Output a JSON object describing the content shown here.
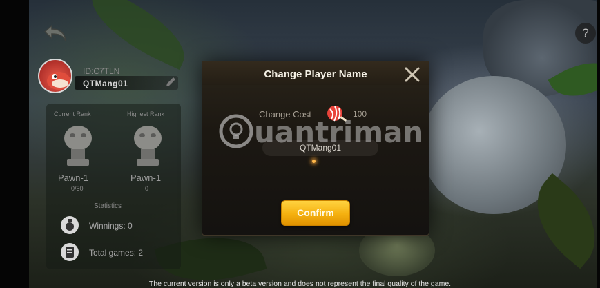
{
  "player": {
    "id_label": "ID:C7TLN",
    "name": "QTMang01"
  },
  "ranks": {
    "current": {
      "title": "Current Rank",
      "name": "Pawn-1",
      "progress": "0/50"
    },
    "highest": {
      "title": "Highest Rank",
      "name": "Pawn-1",
      "progress": "0"
    }
  },
  "statistics": {
    "title": "Statistics",
    "winnings": "Winnings: 0",
    "total_games": "Total games: 2"
  },
  "dialog": {
    "title": "Change Player Name",
    "cost_label": "Change Cost",
    "cost_value": "100",
    "name_value": "QTMang01",
    "confirm_label": "Confirm"
  },
  "help_label": "?",
  "footer_note": "The current version is only a beta version and does not represent the final quality of the game.",
  "watermark_text": "Quantrimang",
  "colors": {
    "confirm_button": "#f5b00f",
    "dialog_background": "#1c1812",
    "title_text": "#f3efe4"
  },
  "icons": [
    "back-arrow-icon",
    "help-icon",
    "edit-pencil-icon",
    "close-icon",
    "candy-icon",
    "pawn-trophy-icon",
    "medal-icon",
    "scroll-icon"
  ]
}
